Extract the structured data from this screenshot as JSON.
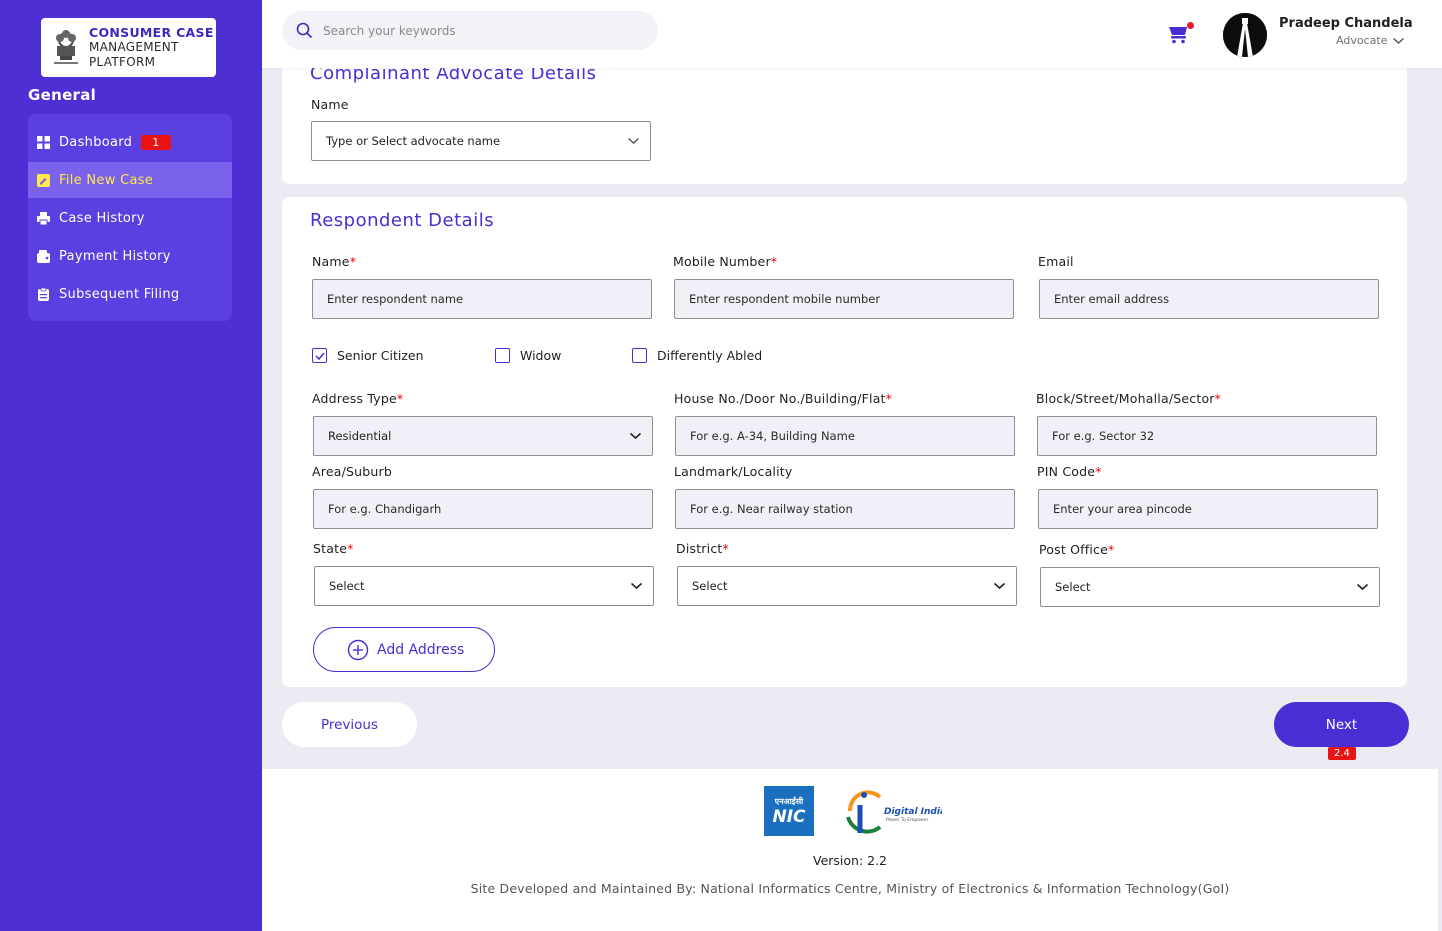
{
  "brand": {
    "line1": "CONSUMER CASE",
    "line2": "MANAGEMENT",
    "line3": "PLATFORM"
  },
  "sidebar": {
    "section_title": "General",
    "items": [
      {
        "label": "Dashboard",
        "icon": "grid-icon",
        "badge": "1"
      },
      {
        "label": "File New Case",
        "icon": "edit-note-icon",
        "active": true
      },
      {
        "label": "Case History",
        "icon": "print-history-icon"
      },
      {
        "label": "Payment History",
        "icon": "wallet-icon"
      },
      {
        "label": "Subsequent Filing",
        "icon": "clipboard-icon"
      }
    ]
  },
  "header": {
    "search_placeholder": "Search your keywords",
    "user_name": "Pradeep Chandela",
    "user_role": "Advocate"
  },
  "advocate_section": {
    "title": "Complainant Advocate Details",
    "name_label": "Name",
    "name_placeholder": "Type or Select advocate name"
  },
  "respondent": {
    "title": "Respondent Details",
    "name_label": "Name",
    "name_placeholder": "Enter respondent name",
    "mobile_label": "Mobile Number",
    "mobile_placeholder": "Enter respondent mobile number",
    "email_label": "Email",
    "email_placeholder": "Enter email address",
    "checkboxes": [
      {
        "label": "Senior Citizen",
        "checked": true
      },
      {
        "label": "Widow",
        "checked": false
      },
      {
        "label": "Differently Abled",
        "checked": false
      }
    ],
    "address_type_label": "Address Type",
    "address_type_value": "Residential",
    "house_label": "House No./Door No./Building/Flat",
    "house_placeholder": "For e.g. A-34, Building Name",
    "block_label": "Block/Street/Mohalla/Sector",
    "block_placeholder": "For e.g. Sector 32",
    "area_label": "Area/Suburb",
    "area_placeholder": "For e.g. Chandigarh",
    "landmark_label": "Landmark/Locality",
    "landmark_placeholder": "For e.g. Near railway station",
    "pin_label": "PIN Code",
    "pin_placeholder": "Enter your area pincode",
    "state_label": "State",
    "state_value": "Select",
    "district_label": "District",
    "district_value": "Select",
    "post_office_label": "Post Office",
    "post_office_value": "Select",
    "add_address_label": "Add Address",
    "required_mark": "*"
  },
  "nav": {
    "previous_label": "Previous",
    "next_label": "Next",
    "next_badge": "2.4"
  },
  "footer": {
    "nic_hindi": "एनआईसी",
    "nic_text": "NIC",
    "digital_india": "Digital India",
    "digital_india_tag": "Power To Empower",
    "version": "Version: 2.2",
    "developed_by": "Site Developed and Maintained By: National Informatics Centre, Ministry of Electronics & Information Technology(GoI)"
  },
  "colors": {
    "sidebar": "#4e2fd4",
    "accent": "#4a2ed4",
    "active_text": "#ffe94a",
    "badge": "#e81414"
  }
}
